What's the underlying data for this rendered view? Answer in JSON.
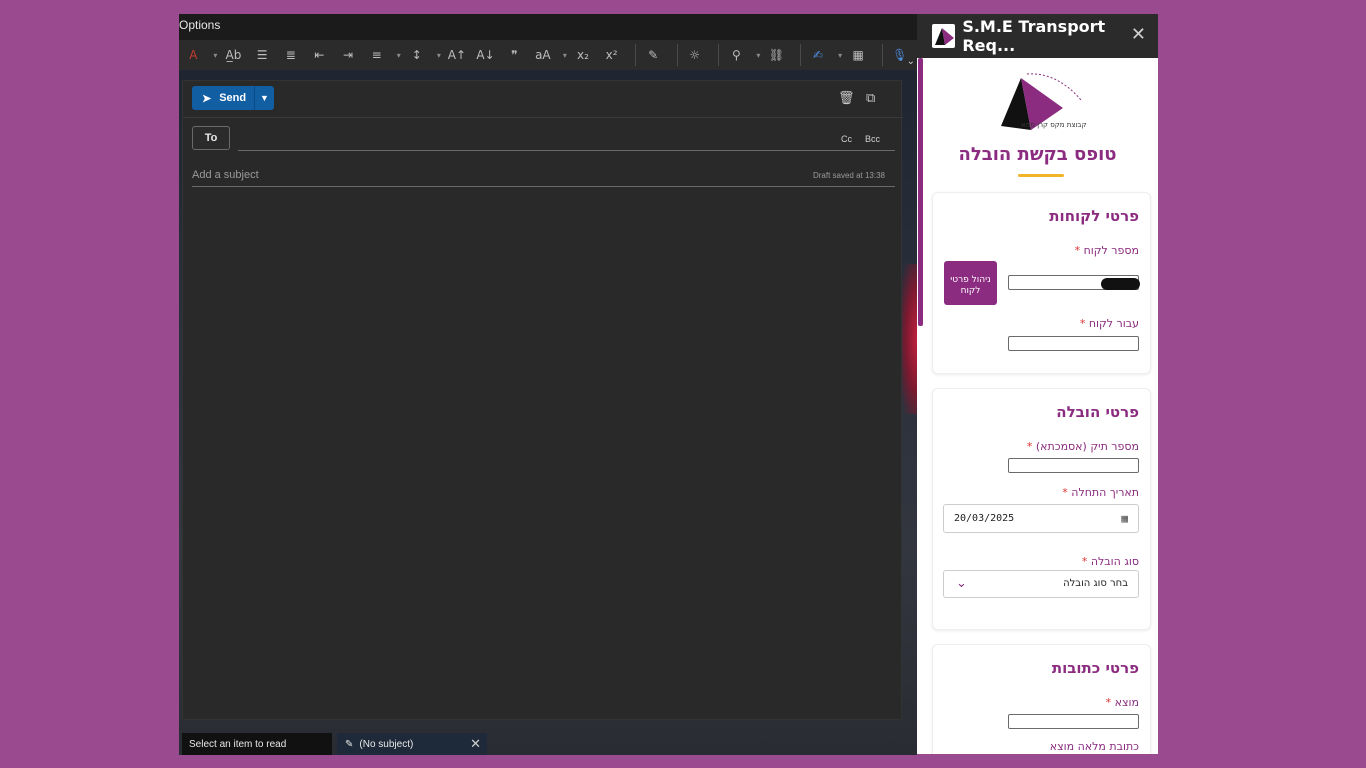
{
  "outlook": {
    "window_title": "Options",
    "send_label": "Send",
    "to_label": "To",
    "cc_label": "Cc",
    "bcc_label": "Bcc",
    "subject_placeholder": "Add a subject",
    "draft_status": "Draft saved at 13:38",
    "status_text": "Select an item to read",
    "draft_tab_label": "(No subject)"
  },
  "addin": {
    "title": "S.M.E Transport Req...",
    "logo_text": "מקבוצת מקס קרן סמא",
    "form_title": "טופס בקשת הובלה",
    "customer_section": {
      "heading": "פרטי לקוחות",
      "customer_number_label": "מספר לקוח",
      "manage_button": "ניהול פרטי לקוח",
      "for_customer_label": "עבור לקוח"
    },
    "shipment_section": {
      "heading": "פרטי הובלה",
      "file_number_label": "מספר תיק (אסמכתא)",
      "start_date_label": "תאריך התחלה",
      "start_date_value": "20/03/2025",
      "shipment_type_label": "סוג הובלה",
      "shipment_type_placeholder": "בחר סוג הובלה"
    },
    "address_section": {
      "heading": "פרטי כתובות",
      "origin_label": "מוצא",
      "origin_full_address_label": "כתובת מלאה מוצא"
    },
    "required_mark": "*"
  },
  "colors": {
    "brand_purple": "#8b2c80",
    "accent_yellow": "#f0b429",
    "send_blue": "#115ea3"
  }
}
